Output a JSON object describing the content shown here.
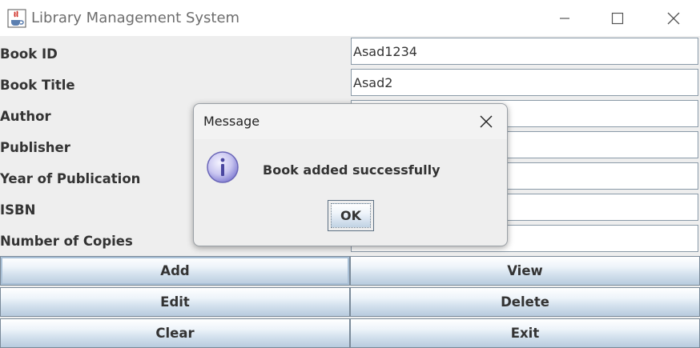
{
  "window": {
    "title": "Library Management System",
    "icon": "java-cup-icon"
  },
  "form": {
    "fields": [
      {
        "label": "Book ID",
        "value": "Asad1234"
      },
      {
        "label": "Book Title",
        "value": "Asad2"
      },
      {
        "label": "Author",
        "value": ""
      },
      {
        "label": "Publisher",
        "value": ""
      },
      {
        "label": "Year of Publication",
        "value": ""
      },
      {
        "label": "ISBN",
        "value": ""
      },
      {
        "label": "Number of Copies",
        "value": ""
      }
    ]
  },
  "buttons": {
    "add": "Add",
    "view": "View",
    "edit": "Edit",
    "delete": "Delete",
    "clear": "Clear",
    "exit": "Exit"
  },
  "dialog": {
    "title": "Message",
    "icon": "info-icon",
    "message": "Book added successfully",
    "ok": "OK"
  },
  "colors": {
    "panel_background": "#eeeeee",
    "button_border": "#7a8a99",
    "info_icon": "#8a86d6"
  }
}
